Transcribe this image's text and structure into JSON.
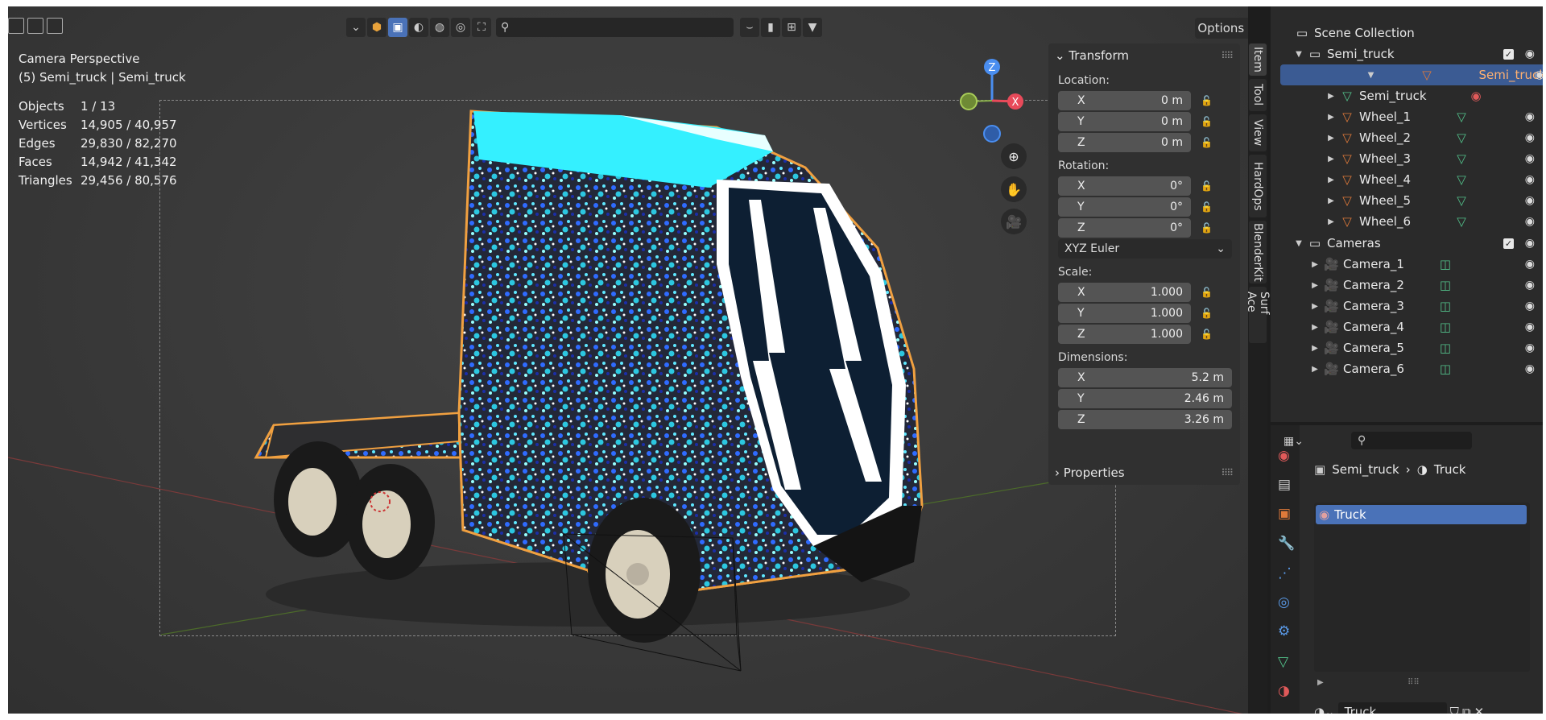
{
  "viewport": {
    "mode_label": "Camera Perspective",
    "object_label": "(5) Semi_truck | Semi_truck",
    "stats": [
      {
        "label": "Objects",
        "value": "1 / 13"
      },
      {
        "label": "Vertices",
        "value": "14,905 / 40,957"
      },
      {
        "label": "Edges",
        "value": "29,830 / 82,270"
      },
      {
        "label": "Faces",
        "value": "14,942 / 41,342"
      },
      {
        "label": "Triangles",
        "value": "29,456 / 80,576"
      }
    ],
    "options_label": "Options",
    "gizmo": {
      "z": "Z",
      "x": "X"
    }
  },
  "transform": {
    "title": "Transform",
    "location_label": "Location:",
    "location": [
      {
        "axis": "X",
        "value": "0 m"
      },
      {
        "axis": "Y",
        "value": "0 m"
      },
      {
        "axis": "Z",
        "value": "0 m"
      }
    ],
    "rotation_label": "Rotation:",
    "rotation": [
      {
        "axis": "X",
        "value": "0°"
      },
      {
        "axis": "Y",
        "value": "0°"
      },
      {
        "axis": "Z",
        "value": "0°"
      }
    ],
    "rotation_mode": "XYZ Euler",
    "scale_label": "Scale:",
    "scale": [
      {
        "axis": "X",
        "value": "1.000"
      },
      {
        "axis": "Y",
        "value": "1.000"
      },
      {
        "axis": "Z",
        "value": "1.000"
      }
    ],
    "dimensions_label": "Dimensions:",
    "dimensions": [
      {
        "axis": "X",
        "value": "5.2 m"
      },
      {
        "axis": "Y",
        "value": "2.46 m"
      },
      {
        "axis": "Z",
        "value": "3.26 m"
      }
    ],
    "properties_label": "Properties"
  },
  "side_tabs": [
    "Item",
    "Tool",
    "View",
    "HardOps",
    "BlenderKit",
    "Surf Ace"
  ],
  "outliner": {
    "rows": [
      {
        "label": "Scene Collection",
        "kind": "scene"
      },
      {
        "label": "Semi_truck",
        "kind": "collection"
      },
      {
        "label": "Semi_truck",
        "kind": "object-selected"
      },
      {
        "label": "Semi_truck",
        "kind": "mesh-data"
      },
      {
        "label": "Wheel_1",
        "kind": "object"
      },
      {
        "label": "Wheel_2",
        "kind": "object"
      },
      {
        "label": "Wheel_3",
        "kind": "object"
      },
      {
        "label": "Wheel_4",
        "kind": "object"
      },
      {
        "label": "Wheel_5",
        "kind": "object"
      },
      {
        "label": "Wheel_6",
        "kind": "object"
      },
      {
        "label": "Cameras",
        "kind": "collection"
      },
      {
        "label": "Camera_1",
        "kind": "camera"
      },
      {
        "label": "Camera_2",
        "kind": "camera"
      },
      {
        "label": "Camera_3",
        "kind": "camera"
      },
      {
        "label": "Camera_4",
        "kind": "camera"
      },
      {
        "label": "Camera_5",
        "kind": "camera"
      },
      {
        "label": "Camera_6",
        "kind": "camera"
      }
    ]
  },
  "properties": {
    "breadcrumb_object": "Semi_truck",
    "breadcrumb_material": "Truck",
    "material_slot": "Truck",
    "material_name": "Truck"
  },
  "colors": {
    "selection": "#3b5b93",
    "active_button": "#4a72b8",
    "object_orange": "#e07a3a",
    "data_green": "#53c28b",
    "truck_outline": "#f0a040",
    "truck_cyan": "#34f0ff"
  }
}
